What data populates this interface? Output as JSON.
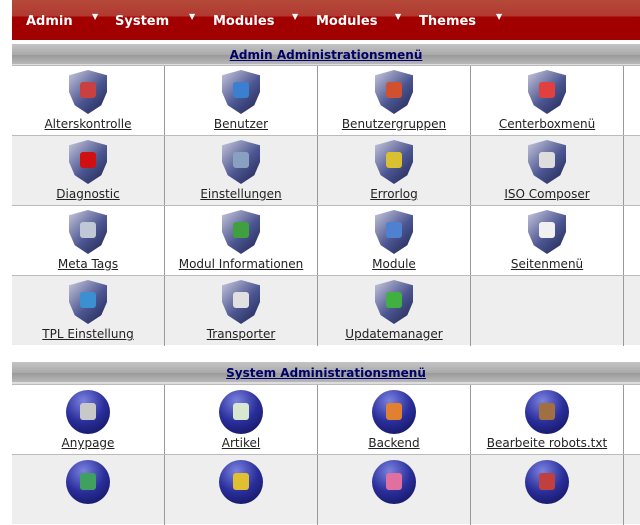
{
  "nav": [
    {
      "label": "Admin"
    },
    {
      "label": "System"
    },
    {
      "label": "Modules"
    },
    {
      "label": "Modules"
    },
    {
      "label": "Themes"
    }
  ],
  "admin": {
    "title": "Admin Administrationsmenü",
    "items": [
      {
        "label": "Alterskontrolle",
        "icon": "age-control-icon",
        "color": "#c84040"
      },
      {
        "label": "Benutzer",
        "icon": "user-icon",
        "color": "#3a7fd0"
      },
      {
        "label": "Benutzergruppen",
        "icon": "user-group-icon",
        "color": "#d05030"
      },
      {
        "label": "Centerboxmenü",
        "icon": "centerbox-icon",
        "color": "#e04040"
      },
      {
        "label": "Diagnostic",
        "icon": "diagnostic-icon",
        "color": "#d01010"
      },
      {
        "label": "Einstellungen",
        "icon": "settings-icon",
        "color": "#8aa0c0"
      },
      {
        "label": "Errorlog",
        "icon": "errorlog-icon",
        "color": "#d8c030"
      },
      {
        "label": "ISO Composer",
        "icon": "cd-icon",
        "color": "#dddddd"
      },
      {
        "label": "Meta Tags",
        "icon": "meta-tags-icon",
        "color": "#c0c8d8"
      },
      {
        "label": "Modul Informationen",
        "icon": "info-icon",
        "color": "#40a040"
      },
      {
        "label": "Module",
        "icon": "module-icon",
        "color": "#5080d0"
      },
      {
        "label": "Seitenmenü",
        "icon": "page-menu-icon",
        "color": "#f0f0f0"
      },
      {
        "label": "TPL Einstellung",
        "icon": "template-icon",
        "color": "#3a90d0"
      },
      {
        "label": "Transporter",
        "icon": "truck-icon",
        "color": "#e0e0e0"
      },
      {
        "label": "Updatemanager",
        "icon": "update-icon",
        "color": "#40b040"
      }
    ]
  },
  "system": {
    "title": "System Administrationsmenü",
    "items": [
      {
        "label": "Anypage",
        "icon": "anypage-icon",
        "color": "#c8c8c8"
      },
      {
        "label": "Artikel",
        "icon": "article-icon",
        "color": "#d8e8d0"
      },
      {
        "label": "Backend",
        "icon": "rss-icon",
        "color": "#e08030"
      },
      {
        "label": "Bearbeite robots.txt",
        "icon": "robot-spider-icon",
        "color": "#a07040"
      },
      {
        "label": "",
        "icon": "system-icon-5",
        "color": "#40a060"
      },
      {
        "label": "",
        "icon": "system-icon-6",
        "color": "#e0c030"
      },
      {
        "label": "",
        "icon": "system-icon-7",
        "color": "#e070a0"
      },
      {
        "label": "",
        "icon": "system-icon-8",
        "color": "#c04040"
      }
    ]
  }
}
